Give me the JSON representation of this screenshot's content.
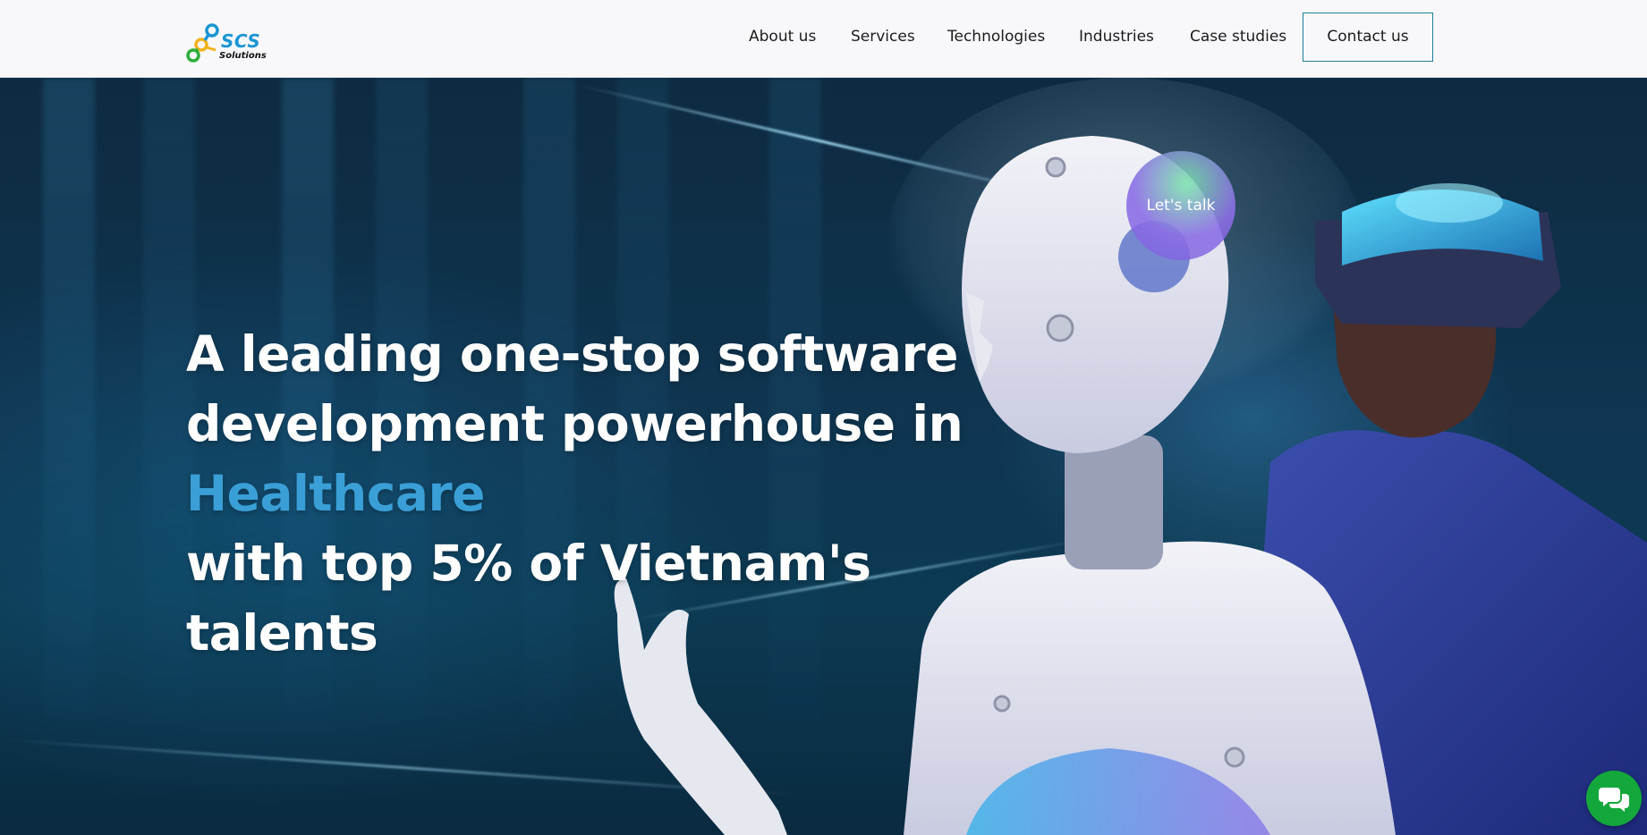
{
  "header": {
    "logo": {
      "brand": "SCS",
      "tagline": "Solutions"
    },
    "nav": [
      {
        "label": "About us"
      },
      {
        "label": "Services"
      },
      {
        "label": "Technologies"
      },
      {
        "label": "Industries"
      },
      {
        "label": "Case studies"
      }
    ],
    "contact_label": "Contact us"
  },
  "hero": {
    "headline_lines": [
      "A leading one-stop software",
      "development powerhouse in",
      "Healthcare",
      "with top 5% of Vietnam's",
      "talents"
    ],
    "accent_color": "#3a9fd6",
    "lets_talk_label": "Let's talk"
  },
  "icons": {
    "chat": "chat-bubbles-icon",
    "logo": "scs-logo-icon"
  },
  "colors": {
    "header_bg": "#f8f8fb",
    "contact_border": "#1e7f99",
    "chat_button": "#14a83c",
    "lets_talk_gradient": [
      "#78e6aa",
      "#8c6ee6"
    ]
  }
}
